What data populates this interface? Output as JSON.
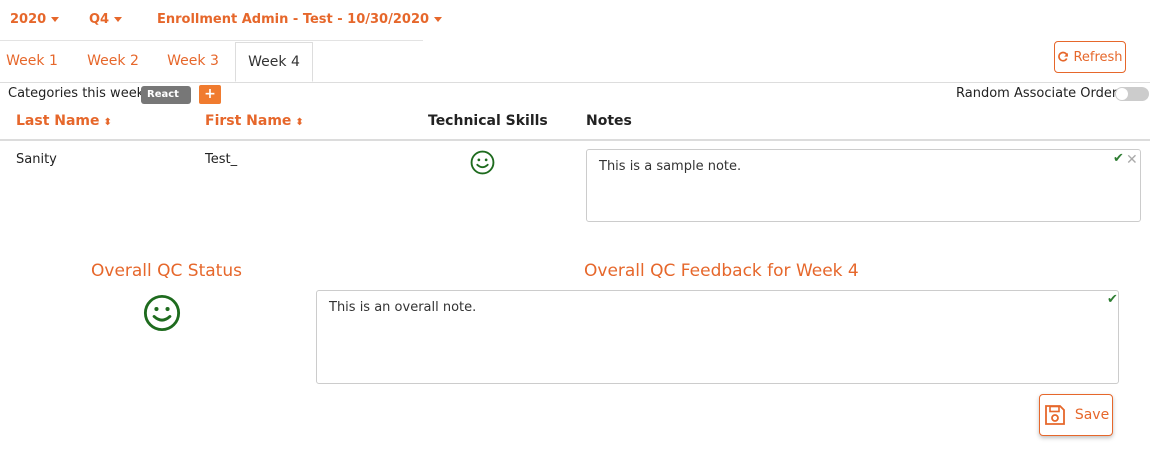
{
  "header": {
    "year": "2020",
    "quarter": "Q4",
    "batch": "Enrollment Admin - Test - 10/30/2020"
  },
  "tabs": [
    {
      "label": "Week 1",
      "active": false
    },
    {
      "label": "Week 2",
      "active": false
    },
    {
      "label": "Week 3",
      "active": false
    },
    {
      "label": "Week 4",
      "active": true
    }
  ],
  "toolbar": {
    "refresh_label": "Refresh",
    "categories_label": "Categories this week:",
    "category_badge": "React",
    "add_label": "+",
    "random_order_label": "Random Associate Order:"
  },
  "table": {
    "columns": [
      "Last Name",
      "First Name",
      "Technical Skills",
      "Notes"
    ],
    "rows": [
      {
        "last_name": "Sanity",
        "first_name": "Test_",
        "technical_skills": "smiley-icon",
        "note": "This is a sample note."
      }
    ]
  },
  "overall": {
    "status_title": "Overall QC Status",
    "status_icon": "smiley-icon",
    "feedback_title": "Overall QC Feedback for Week 4",
    "feedback_text": "This is an overall note.",
    "save_label": "Save"
  },
  "colors": {
    "accent": "#e6672b",
    "smiley": "#1e6b1e",
    "check": "#2e7d32",
    "badge": "#777777"
  }
}
